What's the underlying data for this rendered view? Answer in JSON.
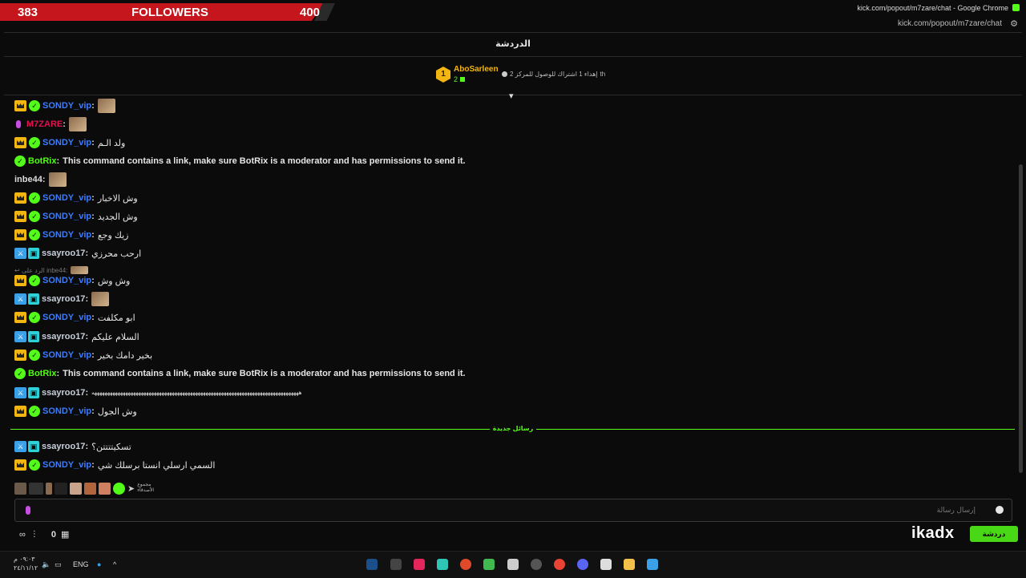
{
  "overlay": {
    "followers_current": "383",
    "followers_label": "FOLLOWERS",
    "followers_goal": "400"
  },
  "browser": {
    "window_title": "kick.com/popout/m7zare/chat - Google Chrome",
    "url": "kick.com/popout/m7zare/chat"
  },
  "chat": {
    "title": "الدردشة",
    "pinned": {
      "rank": "1",
      "username": "AboSarleen",
      "count": "2",
      "text": "إهداء 1 اشتراك للوصول للمركز 2",
      "suffix": "th"
    },
    "messages": [
      {
        "badges": [
          "crown",
          "verified"
        ],
        "user": "SONDY_vip",
        "style": "sondy",
        "text": "",
        "emote": true
      },
      {
        "badges": [
          "mic"
        ],
        "user": "M7ZARE",
        "style": "m7",
        "text": "",
        "emote": true
      },
      {
        "badges": [
          "crown",
          "verified"
        ],
        "user": "SONDY_vip",
        "style": "sondy",
        "text": "ولد الـم"
      },
      {
        "badges": [
          "verified"
        ],
        "user": "BotRix",
        "style": "bot",
        "text": "This command contains a link, make sure BotRix is a moderator and has permissions to send it."
      },
      {
        "badges": [],
        "user": "inbe44",
        "style": "white",
        "text": "",
        "emote": true
      },
      {
        "badges": [
          "crown",
          "verified"
        ],
        "user": "SONDY_vip",
        "style": "sondy",
        "text": "وش الاخبار"
      },
      {
        "badges": [
          "crown",
          "verified"
        ],
        "user": "SONDY_vip",
        "style": "sondy",
        "text": "وش الجديد"
      },
      {
        "badges": [
          "crown",
          "verified"
        ],
        "user": "SONDY_vip",
        "style": "sondy",
        "text": "زيك وجع"
      },
      {
        "badges": [
          "mod",
          "sub"
        ],
        "user": "ssayroo17",
        "style": "ssay",
        "text": "ارحب محرزي"
      },
      {
        "badges": [
          "crown",
          "verified"
        ],
        "user": "SONDY_vip",
        "style": "sondy",
        "text": "وش وش"
      },
      {
        "badges": [
          "mod",
          "sub"
        ],
        "user": "ssayroo17",
        "style": "ssay",
        "text": "",
        "emote": true
      },
      {
        "badges": [
          "crown",
          "verified"
        ],
        "user": "SONDY_vip",
        "style": "sondy",
        "text": "ابو مكلفت"
      },
      {
        "badges": [
          "mod",
          "sub"
        ],
        "user": "ssayroo17",
        "style": "ssay",
        "text": "السلام عليكم"
      },
      {
        "badges": [
          "crown",
          "verified"
        ],
        "user": "SONDY_vip",
        "style": "sondy",
        "text": "بخير دامك بخير"
      },
      {
        "badges": [
          "verified"
        ],
        "user": "BotRix",
        "style": "bot",
        "text": "This command contains a link, make sure BotRix is a moderator and has permissions to send it."
      },
      {
        "badges": [
          "mod",
          "sub"
        ],
        "user": "ssayroo17",
        "style": "ssay",
        "text": "ههههههههههههههههههههههههههههههههههههههههههههههههههههههههههههههههههههههههههههههههه"
      },
      {
        "badges": [
          "crown",
          "verified"
        ],
        "user": "SONDY_vip",
        "style": "sondy",
        "text": "وش الجول"
      },
      {
        "badges": [
          "mod",
          "sub"
        ],
        "user": "ssayroo17",
        "style": "ssay",
        "text": "تسكيتتتتن؟"
      },
      {
        "badges": [
          "crown",
          "verified"
        ],
        "user": "SONDY_vip",
        "style": "sondy",
        "text": "السمي ارسلي انستا برسلك شي"
      }
    ],
    "reply_preview": {
      "prefix": "الرد على",
      "user": "inbe44:"
    },
    "new_messages_label": "رسائل جديدة",
    "input_placeholder": "إرسال رسالة",
    "footer": {
      "count": "0",
      "chat_button": "دردشة"
    },
    "emote_bar_label": "مجموع الأصدقاء"
  },
  "watermark": "ikadx",
  "taskbar": {
    "language": "ENG",
    "time": "٠٩:٠٣ م",
    "date": "٢٤/١١/١٢"
  },
  "colors": {
    "kick_green": "#53fc18",
    "follower_red": "#c4161c",
    "sondy_blue": "#3b7cff",
    "m7zare_red": "#e0134f",
    "gold": "#f2b511"
  }
}
